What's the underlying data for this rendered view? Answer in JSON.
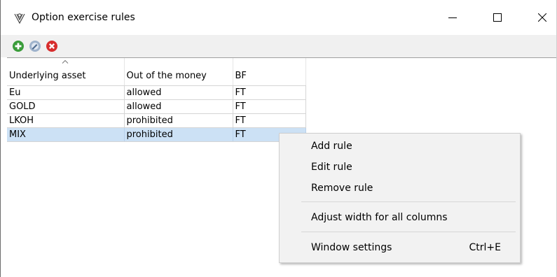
{
  "window": {
    "title": "Option exercise rules",
    "app_icon": "options-app-icon",
    "controls": [
      "minimize-icon",
      "maximize-icon",
      "close-icon"
    ]
  },
  "toolbar": {
    "buttons": [
      {
        "icon": "add-icon",
        "color": "#3a9c3a"
      },
      {
        "icon": "edit-icon",
        "color": "#7a9cc4"
      },
      {
        "icon": "remove-icon",
        "color": "#d72d2d"
      }
    ]
  },
  "grid": {
    "columns": [
      "Underlying asset",
      "Out of the money",
      "BF"
    ],
    "sorted_column": 0,
    "rows": [
      [
        "Eu",
        "allowed",
        "FT"
      ],
      [
        "GOLD",
        "allowed",
        "FT"
      ],
      [
        "LKOH",
        "prohibited",
        "FT"
      ],
      [
        "MIX",
        "prohibited",
        "FT"
      ]
    ],
    "selected_row": 3,
    "selection_color": "#cce1f5"
  },
  "context_menu": {
    "items": [
      {
        "label": "Add rule",
        "shortcut": ""
      },
      {
        "label": "Edit rule",
        "shortcut": ""
      },
      {
        "label": "Remove rule",
        "shortcut": ""
      },
      {
        "label": "Adjust width for all columns",
        "shortcut": ""
      },
      {
        "label": "Window settings",
        "shortcut": "Ctrl+E"
      }
    ]
  }
}
